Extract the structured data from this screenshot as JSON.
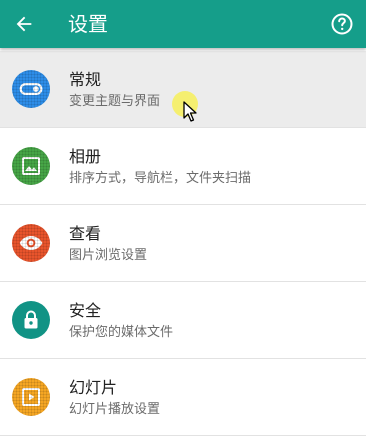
{
  "appbar": {
    "title": "设置",
    "back_icon": "arrow-left-icon",
    "help_icon": "help-circle-icon",
    "color": "#159e8a"
  },
  "items": [
    {
      "title": "常规",
      "subtitle": "变更主题与界面",
      "icon": "toggle-icon",
      "color": "#2d8de8"
    },
    {
      "title": "相册",
      "subtitle": "排序方式，导航栏，文件夹扫描",
      "icon": "image-icon",
      "color": "#46a546"
    },
    {
      "title": "查看",
      "subtitle": "图片浏览设置",
      "icon": "eye-icon",
      "color": "#e8542c"
    },
    {
      "title": "安全",
      "subtitle": "保护您的媒体文件",
      "icon": "lock-icon",
      "color": "#119385"
    },
    {
      "title": "幻灯片",
      "subtitle": "幻灯片播放设置",
      "icon": "slideshow-icon",
      "color": "#f5a623"
    }
  ]
}
